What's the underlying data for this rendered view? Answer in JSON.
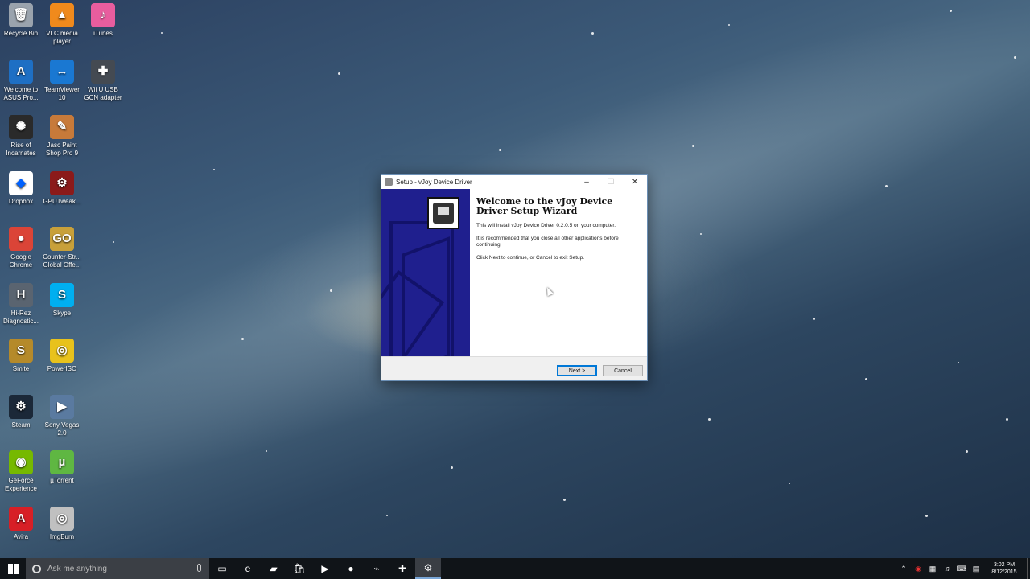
{
  "desktop": {
    "icons": [
      {
        "label": "Recycle Bin",
        "icon": "recycle-bin-icon",
        "color": "#9aa3ad",
        "glyph": "🗑"
      },
      {
        "label": "VLC media player",
        "icon": "vlc-icon",
        "color": "#f08a1c",
        "glyph": "▲"
      },
      {
        "label": "iTunes",
        "icon": "itunes-icon",
        "color": "#e85d9e",
        "glyph": "♪"
      },
      {
        "label": "Welcome to ASUS Pro...",
        "icon": "asus-icon",
        "color": "#1e6fc4",
        "glyph": "A"
      },
      {
        "label": "TeamViewer 10",
        "icon": "teamviewer-icon",
        "color": "#1a78d2",
        "glyph": "↔"
      },
      {
        "label": "Wii U USB GCN adapter",
        "icon": "gamepad-icon",
        "color": "#444a52",
        "glyph": "✚"
      },
      {
        "label": "Rise of Incarnates",
        "icon": "rise-of-incarnates-icon",
        "color": "#2a2a2a",
        "glyph": "✺"
      },
      {
        "label": "Jasc Paint Shop Pro 9",
        "icon": "paint-shop-icon",
        "color": "#c77a3a",
        "glyph": "✎"
      },
      {
        "label": "Dropbox",
        "icon": "dropbox-icon",
        "color": "#ffffff",
        "glyph": "◆"
      },
      {
        "label": "GPUTweak...",
        "icon": "gputweak-icon",
        "color": "#8b1a1a",
        "glyph": "⚙"
      },
      {
        "label": "Google Chrome",
        "icon": "chrome-icon",
        "color": "#db4437",
        "glyph": "●"
      },
      {
        "label": "Counter-Str... Global Offe...",
        "icon": "csgo-icon",
        "color": "#c8a03a",
        "glyph": "GO"
      },
      {
        "label": "Hi-Rez Diagnostic...",
        "icon": "hirez-icon",
        "color": "#5a6470",
        "glyph": "H"
      },
      {
        "label": "Skype",
        "icon": "skype-icon",
        "color": "#00aff0",
        "glyph": "S"
      },
      {
        "label": "Smite",
        "icon": "smite-icon",
        "color": "#b58a2a",
        "glyph": "S"
      },
      {
        "label": "PowerISO",
        "icon": "poweriso-icon",
        "color": "#e8c21c",
        "glyph": "◎"
      },
      {
        "label": "Steam",
        "icon": "steam-icon",
        "color": "#1b2838",
        "glyph": "⚙"
      },
      {
        "label": "Sony Vegas 2.0",
        "icon": "sony-vegas-icon",
        "color": "#5a7aa0",
        "glyph": "▶"
      },
      {
        "label": "GeForce Experience",
        "icon": "geforce-icon",
        "color": "#76b900",
        "glyph": "◉"
      },
      {
        "label": "µTorrent",
        "icon": "utorrent-icon",
        "color": "#5fb742",
        "glyph": "µ"
      },
      {
        "label": "Avira",
        "icon": "avira-icon",
        "color": "#d71f26",
        "glyph": "A"
      },
      {
        "label": "ImgBurn",
        "icon": "imgburn-icon",
        "color": "#c0c0c0",
        "glyph": "◎"
      }
    ]
  },
  "dialog": {
    "title": "Setup - vJoy Device Driver",
    "minimize": "–",
    "maximize": "☐",
    "close": "✕",
    "heading": "Welcome to the vJoy Device Driver Setup Wizard",
    "para1": "This will install vJoy Device Driver 0.2.0.5 on your computer.",
    "para2": "It is recommended that you close all other applications before continuing.",
    "para3": "Click Next to continue, or Cancel to exit Setup.",
    "next_label": "Next >",
    "cancel_label": "Cancel"
  },
  "taskbar": {
    "search_placeholder": "Ask me anything",
    "apps": [
      {
        "icon": "task-view-icon",
        "glyph": "▭",
        "active": false
      },
      {
        "icon": "edge-icon",
        "glyph": "e",
        "active": false
      },
      {
        "icon": "file-explorer-icon",
        "glyph": "▰",
        "active": false
      },
      {
        "icon": "store-icon",
        "glyph": "🛍",
        "active": false
      },
      {
        "icon": "media-player-icon",
        "glyph": "▶",
        "active": false
      },
      {
        "icon": "chrome-icon",
        "glyph": "●",
        "active": false
      },
      {
        "icon": "app-icon",
        "glyph": "⌁",
        "active": false
      },
      {
        "icon": "gamepad-icon",
        "glyph": "✚",
        "active": false
      },
      {
        "icon": "setup-icon",
        "glyph": "⚙",
        "active": true
      }
    ],
    "time": "3:02 PM",
    "date": "8/12/2015"
  }
}
